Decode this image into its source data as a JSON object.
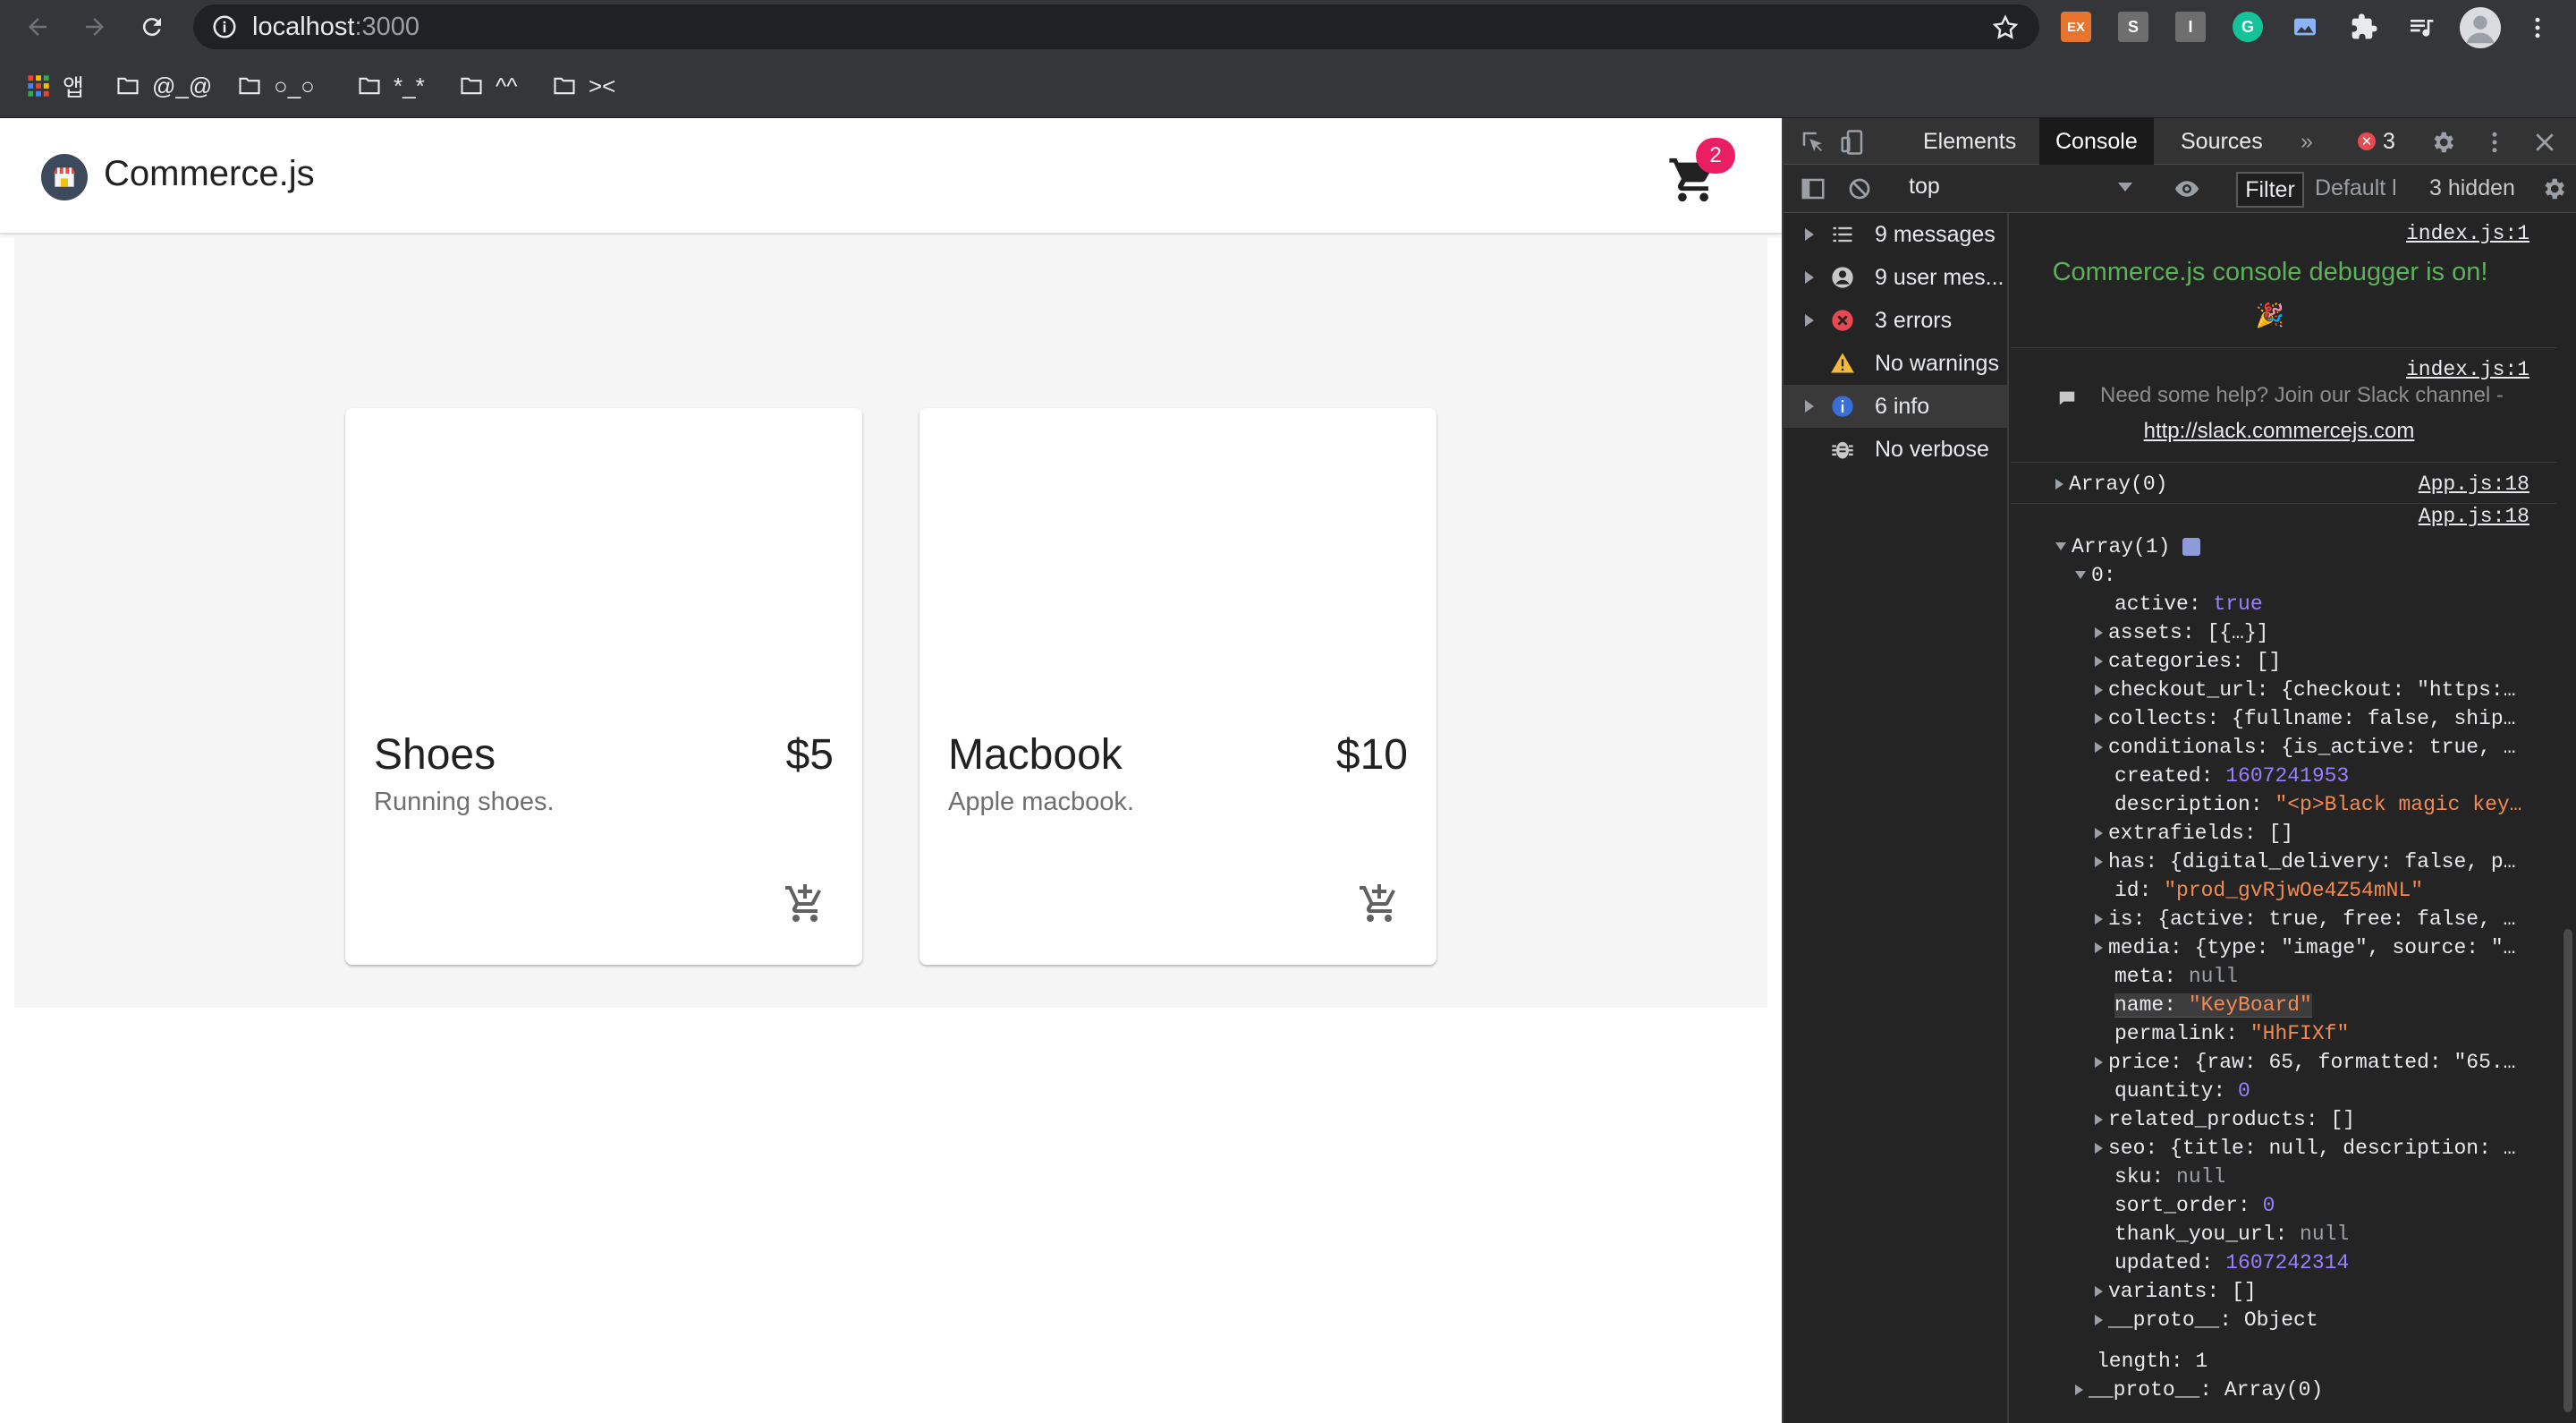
{
  "browser": {
    "url_host": "localhost",
    "url_port": ":3000",
    "bookmarks": [
      {
        "label": "앱",
        "icon": "apps-grid-icon"
      },
      {
        "label": "@_@",
        "icon": "folder-icon"
      },
      {
        "label": "○_○",
        "icon": "folder-icon"
      },
      {
        "label": "*_*",
        "icon": "folder-icon"
      },
      {
        "label": "^^",
        "icon": "folder-icon"
      },
      {
        "label": "><",
        "icon": "folder-icon"
      }
    ],
    "extensions": [
      {
        "label": "EX",
        "color": "#e8742d"
      },
      {
        "label": "S",
        "color": "#6e6e6e"
      },
      {
        "label": "I",
        "color": "#6e6e6e"
      },
      {
        "label": "G",
        "color": "#15c39a"
      }
    ]
  },
  "app": {
    "brand": "Commerce.js",
    "cart_count": "2",
    "products": [
      {
        "name": "Shoes",
        "price": "$5",
        "description": "Running shoes."
      },
      {
        "name": "Macbook",
        "price": "$10",
        "description": "Apple macbook."
      }
    ]
  },
  "devtools": {
    "tabs": [
      "Elements",
      "Console",
      "Sources"
    ],
    "active_tab": "Console",
    "more": "»",
    "error_count": "3",
    "context": "top",
    "filter_label": "Filter",
    "levels_label": "Default l",
    "hidden_label": "3 hidden",
    "sidebar": [
      {
        "label": "9 messages",
        "icon": "list-icon"
      },
      {
        "label": "9 user mes...",
        "icon": "user-icon"
      },
      {
        "label": "3 errors",
        "icon": "error-icon"
      },
      {
        "label": "No warnings",
        "icon": "warning-icon"
      },
      {
        "label": "6 info",
        "icon": "info-icon"
      },
      {
        "label": "No verbose",
        "icon": "bug-icon"
      }
    ],
    "console": {
      "src1": "index.js:1",
      "debug_msg": "Commerce.js console debugger is on!",
      "party": "🎉",
      "src2": "index.js:1",
      "help_msg": "Need some help? Join our Slack channel -",
      "help_link": "http://slack.commercejs.com",
      "arr0": "Array(0)",
      "src3": "App.js:18",
      "src4": "App.js:18",
      "arr1": "Array(1)",
      "idx0": "0:",
      "props": [
        {
          "key": "active",
          "val": "true",
          "type": "vb",
          "exp": false
        },
        {
          "key": "assets",
          "val": "[{…}]",
          "type": "k",
          "exp": true
        },
        {
          "key": "categories",
          "val": "[]",
          "type": "k",
          "exp": true
        },
        {
          "key": "checkout_url",
          "val": "{checkout: \"https:…",
          "type": "k",
          "exp": true
        },
        {
          "key": "collects",
          "val": "{fullname: false, ship…",
          "type": "k",
          "exp": true
        },
        {
          "key": "conditionals",
          "val": "{is_active: true, …",
          "type": "k",
          "exp": true
        },
        {
          "key": "created",
          "val": "1607241953",
          "type": "vn",
          "exp": false
        },
        {
          "key": "description",
          "val": "\"<p>Black magic key…",
          "type": "vs",
          "exp": false
        },
        {
          "key": "extrafields",
          "val": "[]",
          "type": "k",
          "exp": true
        },
        {
          "key": "has",
          "val": "{digital_delivery: false, p…",
          "type": "k",
          "exp": true
        },
        {
          "key": "id",
          "val": "\"prod_gvRjwOe4Z54mNL\"",
          "type": "vs",
          "exp": false
        },
        {
          "key": "is",
          "val": "{active: true, free: false, …",
          "type": "k",
          "exp": true
        },
        {
          "key": "media",
          "val": "{type: \"image\", source: \"…",
          "type": "k",
          "exp": true
        },
        {
          "key": "meta",
          "val": "null",
          "type": "vnull",
          "exp": false
        },
        {
          "key": "name",
          "val": "\"KeyBoard\"",
          "type": "vs",
          "exp": false
        },
        {
          "key": "permalink",
          "val": "\"HhFIXf\"",
          "type": "vs",
          "exp": false
        },
        {
          "key": "price",
          "val": "{raw: 65, formatted: \"65.…",
          "type": "k",
          "exp": true
        },
        {
          "key": "quantity",
          "val": "0",
          "type": "vn",
          "exp": false
        },
        {
          "key": "related_products",
          "val": "[]",
          "type": "k",
          "exp": true
        },
        {
          "key": "seo",
          "val": "{title: null, description: …",
          "type": "k",
          "exp": true
        },
        {
          "key": "sku",
          "val": "null",
          "type": "vnull",
          "exp": false
        },
        {
          "key": "sort_order",
          "val": "0",
          "type": "vn",
          "exp": false
        },
        {
          "key": "thank_you_url",
          "val": "null",
          "type": "vnull",
          "exp": false
        },
        {
          "key": "updated",
          "val": "1607242314",
          "type": "vn",
          "exp": false
        },
        {
          "key": "variants",
          "val": "[]",
          "type": "k",
          "exp": true
        },
        {
          "key": "__proto__",
          "val": "Object",
          "type": "k",
          "exp": true
        }
      ],
      "length": "length: 1",
      "proto_arr": "__proto__: Array(0)"
    }
  }
}
